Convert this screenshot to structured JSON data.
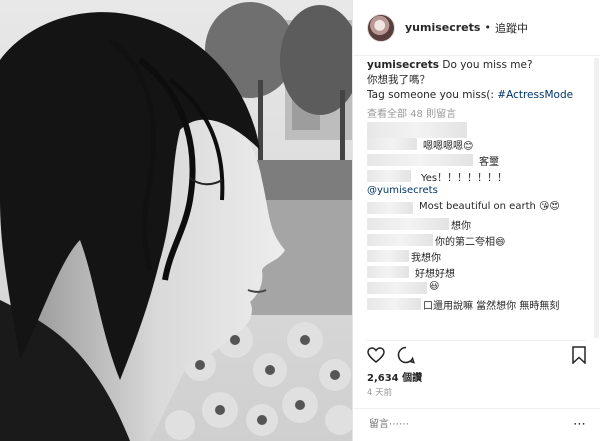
{
  "header": {
    "username": "yumisecrets",
    "separator": "•",
    "follow_status": "追蹤中"
  },
  "caption": {
    "username": "yumisecrets",
    "line1": "Do you miss me?",
    "line2": "你想我了嗎？",
    "line3": "Tag someone you miss(:",
    "hashtag": "#ActressMode"
  },
  "load_more": "查看全部 48 則留言",
  "comments": [
    {
      "text": ""
    },
    {
      "text": "嗯嗯嗯嗯😊"
    },
    {
      "text": "客璽"
    },
    {
      "text": "Yes！！！！！！！"
    },
    {
      "text": "@yumisecrets"
    },
    {
      "text": "Most beautiful on earth 😘😍"
    },
    {
      "text": "想你"
    },
    {
      "text": "你的第二夸相😄"
    },
    {
      "text": "我想你"
    },
    {
      "text": "好想好想"
    },
    {
      "text": "😃"
    },
    {
      "text": "口還用說嘛 當然想你 無時無刻"
    }
  ],
  "likes": "2,634 個讚",
  "time_ago": "4 天前",
  "add_comment": {
    "placeholder": "留言⋯⋯",
    "options": "⋯"
  },
  "icons": [
    "heart-icon",
    "comment-icon",
    "bookmark-icon"
  ]
}
